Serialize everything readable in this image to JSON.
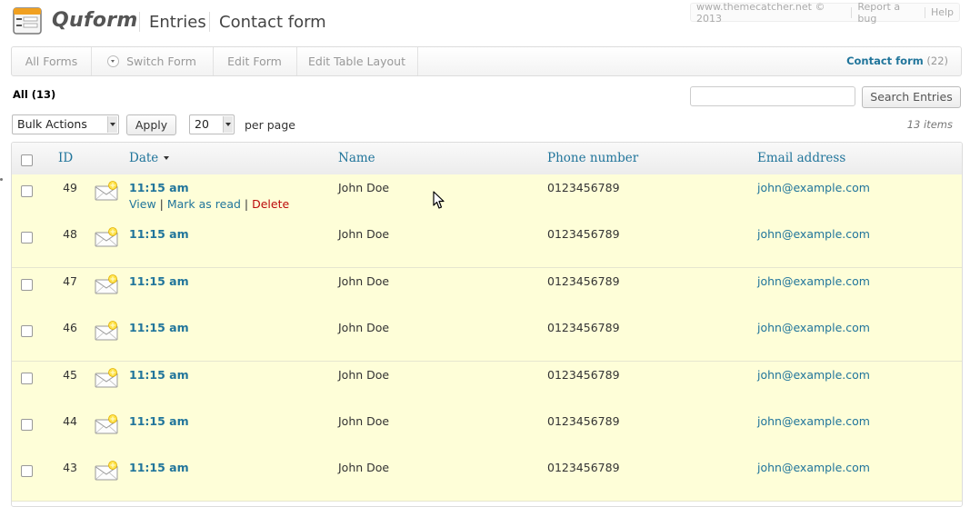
{
  "header": {
    "brand": "Quform",
    "section": "Entries",
    "form_name": "Contact form",
    "links": [
      "www.themecatcher.net © 2013",
      "Report a bug",
      "Help"
    ]
  },
  "nav": {
    "all_forms": "All Forms",
    "switch_form": "Switch Form",
    "edit_form": "Edit Form",
    "edit_layout": "Edit Table Layout",
    "current_form": "Contact form",
    "current_count": "(22)"
  },
  "toolbar": {
    "all_label": "All (13)",
    "search_value": "",
    "search_button": "Search Entries",
    "bulk_actions": "Bulk Actions",
    "apply": "Apply",
    "per_page_value": "20",
    "per_page_label": "per page",
    "items_count": "13 items"
  },
  "table": {
    "columns": {
      "id": "ID",
      "date": "Date",
      "name": "Name",
      "phone": "Phone number",
      "email": "Email address"
    },
    "row_actions": {
      "view": "View",
      "mark_read": "Mark as read",
      "delete": "Delete"
    },
    "rows": [
      {
        "id": "49",
        "time": "11:15 am",
        "name": "John Doe",
        "phone": "0123456789",
        "email": "john@example.com",
        "unread": true
      },
      {
        "id": "48",
        "time": "11:15 am",
        "name": "John Doe",
        "phone": "0123456789",
        "email": "john@example.com",
        "unread": true
      },
      {
        "id": "47",
        "time": "11:15 am",
        "name": "John Doe",
        "phone": "0123456789",
        "email": "john@example.com",
        "unread": true
      },
      {
        "id": "46",
        "time": "11:15 am",
        "name": "John Doe",
        "phone": "0123456789",
        "email": "john@example.com",
        "unread": true
      },
      {
        "id": "45",
        "time": "11:15 am",
        "name": "John Doe",
        "phone": "0123456789",
        "email": "john@example.com",
        "unread": true
      },
      {
        "id": "44",
        "time": "11:15 am",
        "name": "John Doe",
        "phone": "0123456789",
        "email": "john@example.com",
        "unread": true
      },
      {
        "id": "43",
        "time": "11:15 am",
        "name": "John Doe",
        "phone": "0123456789",
        "email": "john@example.com",
        "unread": true
      }
    ]
  },
  "colors": {
    "link": "#21759b",
    "unread_row": "#fefed8",
    "delete": "#bc0b0b"
  }
}
